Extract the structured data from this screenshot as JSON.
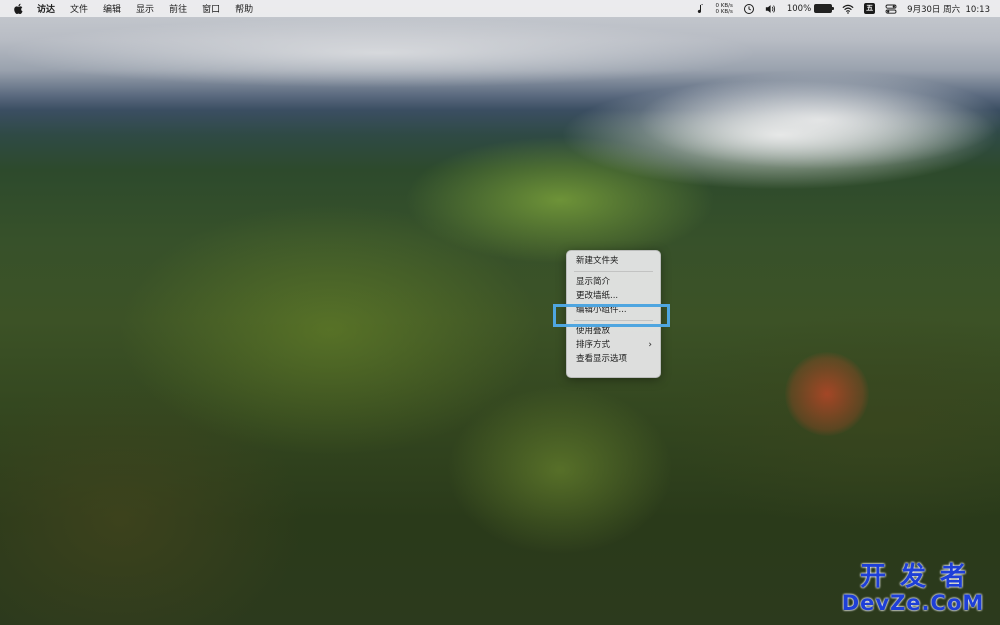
{
  "menubar": {
    "app_name": "访达",
    "menus": [
      "文件",
      "编辑",
      "显示",
      "前往",
      "窗口",
      "帮助"
    ],
    "status": {
      "net_up": "0 KB/s",
      "net_down": "0 KB/s",
      "battery_percent": "100%",
      "battery_badge": "",
      "ime_label": "五",
      "datetime": "9月30日 周六  10:13"
    },
    "icons": [
      "apple-icon",
      "music-note-icon",
      "time-machine-icon",
      "volume-icon",
      "battery-icon",
      "wifi-icon",
      "input-method-icon",
      "control-center-icon"
    ]
  },
  "context_menu": {
    "items": {
      "new_folder": "新建文件夹",
      "get_info": "显示简介",
      "change_wallpaper": "更改墙纸...",
      "edit_widgets": "编辑小组件...",
      "use_stacks": "使用叠放",
      "sort_by": "排序方式",
      "show_view_options": "查看显示选项"
    },
    "highlighted": "edit_widgets"
  },
  "colors": {
    "highlight_border": "#4fa6e0",
    "watermark": "#1e3fd8"
  },
  "watermark": {
    "line1": "开发者",
    "line2": "DevZe.CoM"
  }
}
